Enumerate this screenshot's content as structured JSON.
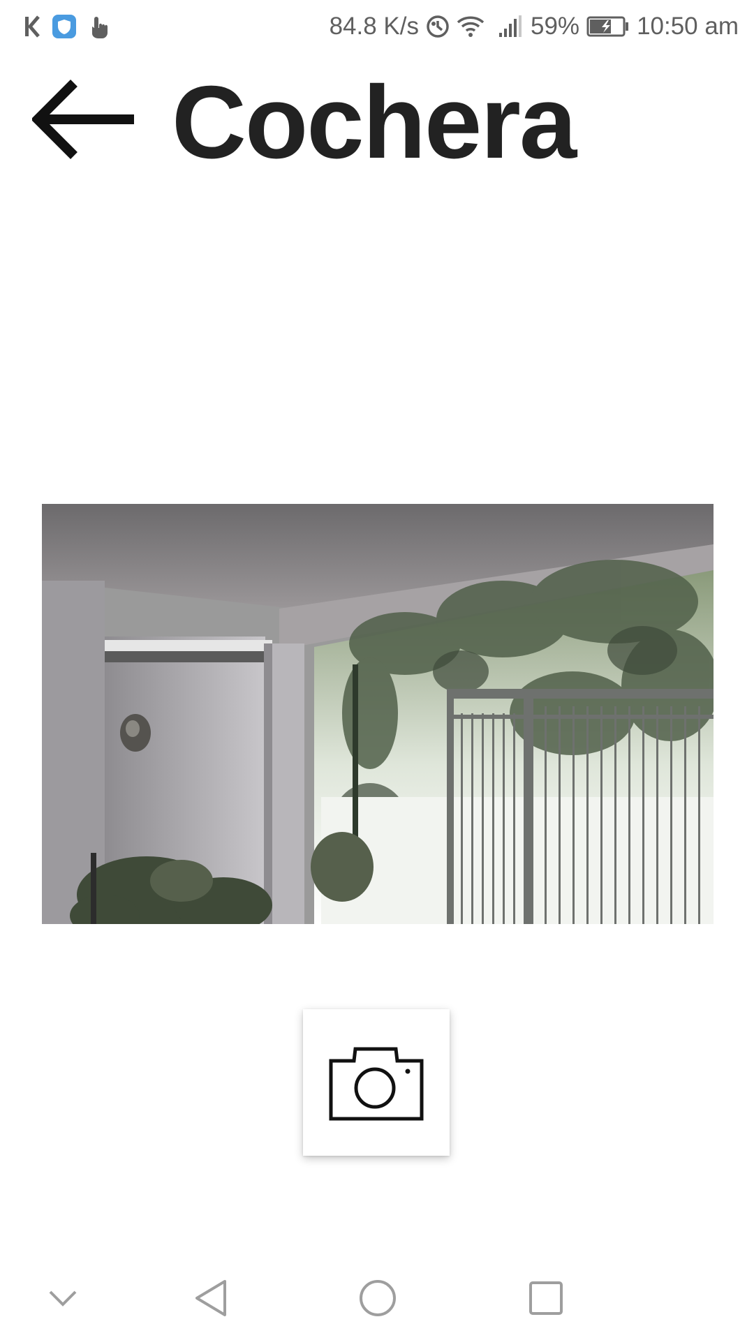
{
  "status_bar": {
    "left_icons": [
      "k-app-icon",
      "shield-icon",
      "touch-hand-icon"
    ],
    "net_speed": "84.8 K/s",
    "battery_percent": "59%",
    "time": "10:50 am",
    "right_icons": [
      "data-saver-icon",
      "wifi-icon",
      "signal-icon",
      "battery-charging-icon"
    ]
  },
  "app_bar": {
    "title": "Cochera",
    "back_icon": "arrow-left-icon"
  },
  "camera": {
    "description_icon": "camera-feed-image"
  },
  "actions": {
    "snapshot_icon": "camera-icon"
  },
  "nav_bar": {
    "items": [
      "chevron-down-icon",
      "back-triangle-icon",
      "home-circle-icon",
      "recents-square-icon"
    ]
  },
  "colors": {
    "text": "#222222",
    "status_text": "#5f5f5f",
    "shield_blue": "#4a9be0",
    "nav_icon": "#9e9e9e"
  }
}
